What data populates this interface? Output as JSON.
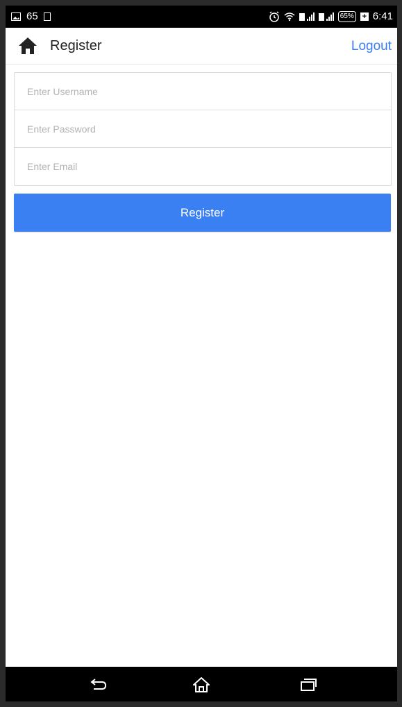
{
  "status_bar": {
    "left_text": "65",
    "battery_text": "65%",
    "time": "6:41",
    "icons": [
      "gallery-icon",
      "sim-icon",
      "alarm-icon",
      "wifi-icon",
      "signal-icon",
      "signal-icon-2",
      "battery-icon"
    ]
  },
  "header": {
    "title": "Register",
    "logout_label": "Logout",
    "home_icon": "home-icon"
  },
  "form": {
    "username": {
      "placeholder": "Enter Username",
      "value": ""
    },
    "password": {
      "placeholder": "Enter Password",
      "value": ""
    },
    "email": {
      "placeholder": "Enter Email",
      "value": ""
    },
    "submit_label": "Register"
  },
  "nav_bar": {
    "icons": [
      "back-icon",
      "home-nav-icon",
      "recent-apps-icon"
    ]
  },
  "colors": {
    "accent": "#3a80f3",
    "link": "#3a7ff0",
    "status_bar": "#000000"
  }
}
